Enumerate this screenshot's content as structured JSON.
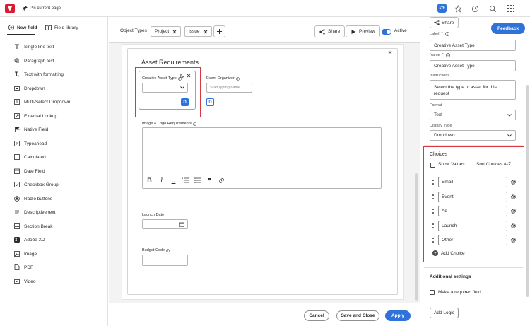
{
  "topbar": {
    "pin_label": "Pin current page",
    "badge": "179"
  },
  "left": {
    "tab_new": "New field",
    "tab_library": "Field library",
    "fields": [
      {
        "label": "Single line text",
        "icon": "text-cursor-icon"
      },
      {
        "label": "Paragraph text",
        "icon": "paragraph-icon"
      },
      {
        "label": "Text with formatting",
        "icon": "rich-text-icon"
      },
      {
        "label": "Dropdown",
        "icon": "dropdown-icon"
      },
      {
        "label": "Multi-Select Dropdown",
        "icon": "multi-dropdown-icon"
      },
      {
        "label": "External Lookup",
        "icon": "lookup-icon"
      },
      {
        "label": "Native Field",
        "icon": "flag-icon"
      },
      {
        "label": "Typeahead",
        "icon": "typeahead-icon"
      },
      {
        "label": "Calculated",
        "icon": "calculator-icon"
      },
      {
        "label": "Date Field",
        "icon": "calendar-icon"
      },
      {
        "label": "Checkbox Group",
        "icon": "checkbox-icon"
      },
      {
        "label": "Radio buttons",
        "icon": "radio-icon"
      },
      {
        "label": "Descriptive text",
        "icon": "text-icon"
      },
      {
        "label": "Section Break",
        "icon": "section-icon"
      },
      {
        "label": "Adobe XD",
        "icon": "xd-icon"
      },
      {
        "label": "Image",
        "icon": "image-icon"
      },
      {
        "label": "PDF",
        "icon": "pdf-icon"
      },
      {
        "label": "Video",
        "icon": "video-icon"
      }
    ]
  },
  "header": {
    "object_types_label": "Object Types",
    "chips": [
      "Project",
      "Issue"
    ],
    "share_label": "Share",
    "preview_label": "Preview",
    "active_label": "Active"
  },
  "form": {
    "section_title": "Asset Requirements",
    "creative_asset_label": "Creative Asset Type",
    "event_organizer_label": "Event Organizer",
    "event_organizer_placeholder": "Start typing name...",
    "d_badge": "D",
    "image_logo_label": "Image & Logo Requirements",
    "launch_date_label": "Launch Date",
    "budget_code_label": "Budget Code"
  },
  "footer": {
    "cancel": "Cancel",
    "save_close": "Save and Close",
    "apply": "Apply"
  },
  "right": {
    "share_label": "Share",
    "feedback": "Feedback",
    "label_label": "Label",
    "label_value": "Creative Asset Type",
    "name_label": "Name",
    "name_value": "Creative Asset Type",
    "instructions_label": "Instructions",
    "instructions_value": "Select the type of asset for this request",
    "format_label": "Format",
    "format_value": "Text",
    "display_type_label": "Display Type",
    "display_type_value": "Dropdown",
    "choices_title": "Choices",
    "show_values": "Show Values",
    "sort_choices": "Sort Choices A-Z",
    "choices": [
      "Email",
      "Event",
      "Ad",
      "Launch",
      "Other"
    ],
    "add_choice": "Add Choice",
    "additional_settings": "Additional settings",
    "required_field": "Make a required field",
    "add_logic": "Add Logic"
  },
  "colors": {
    "accent": "#2f73d8",
    "highlight": "#d7373f",
    "logo": "#e0182d"
  }
}
